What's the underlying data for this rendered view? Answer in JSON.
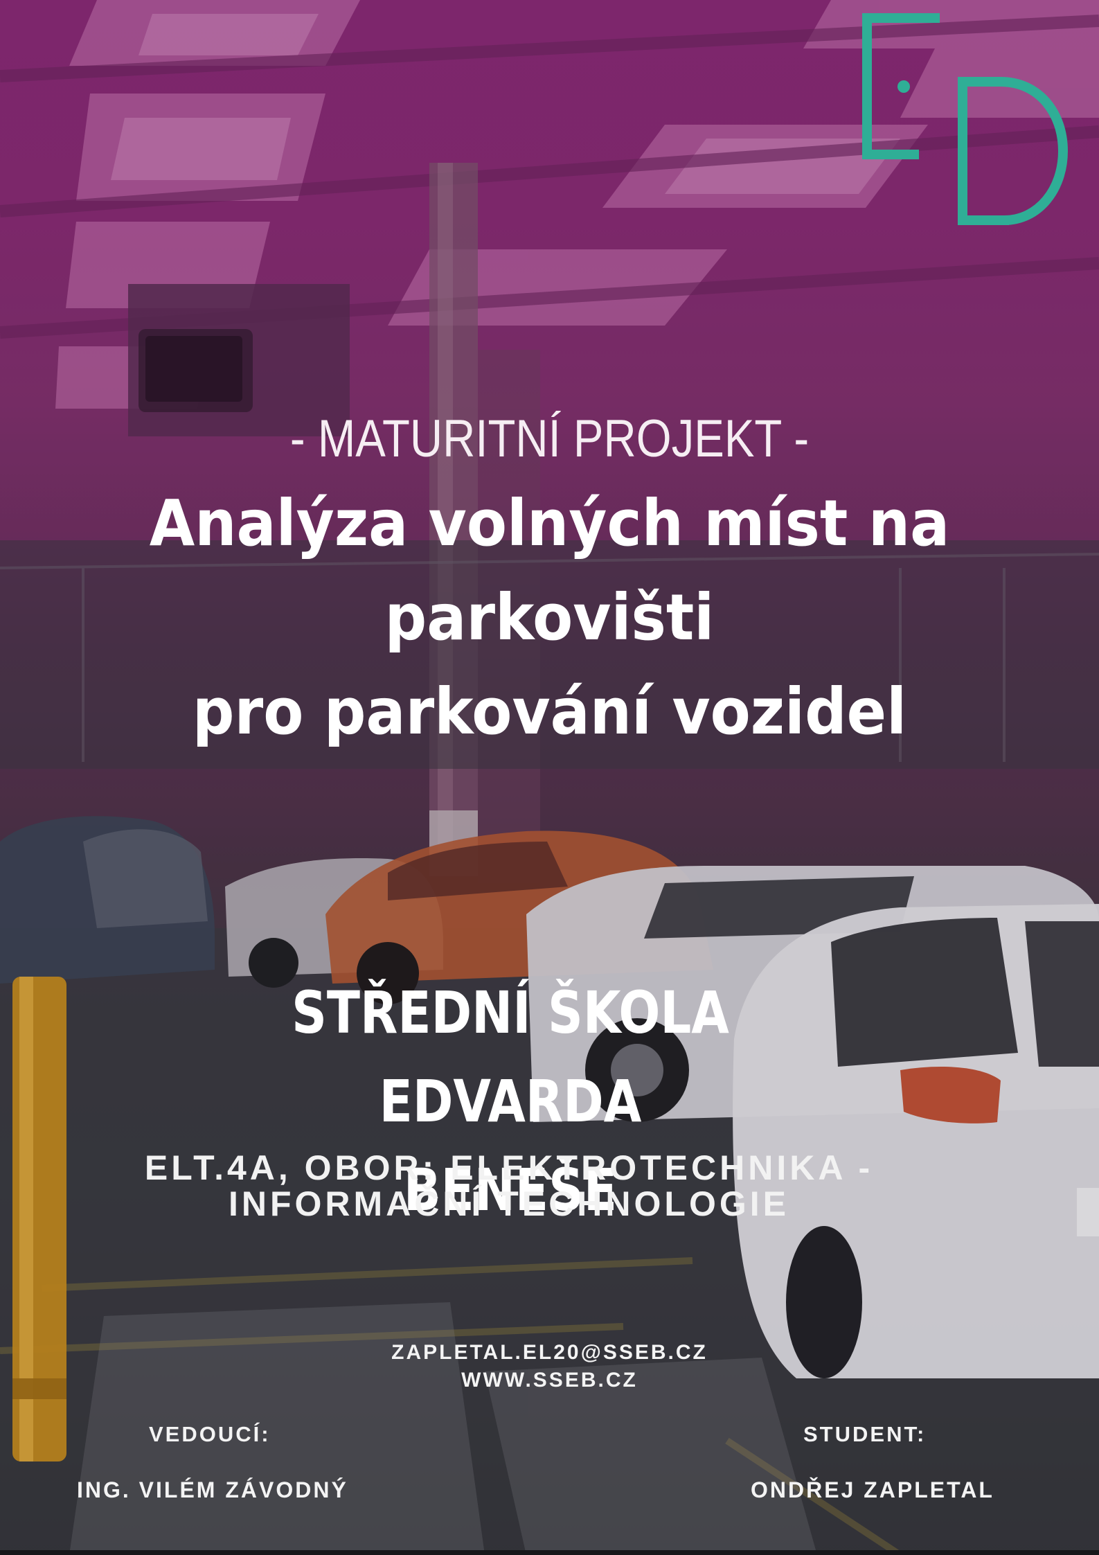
{
  "project_label": "- MATURITNÍ PROJEKT -",
  "title_lines": [
    "Analýza volných míst na",
    "parkovišti",
    "pro parkování vozidel"
  ],
  "school_lines": [
    "STŘEDNÍ ŠKOLA EDVARDA",
    "BENEŠE"
  ],
  "program_lines": [
    "ELT.4A, OBOR: ELEKTROTECHNIKA -",
    "INFORMAČNÍ TECHNOLOGIE"
  ],
  "contact": {
    "email": "ZAPLETAL.EL20@SSEB.CZ",
    "website": "WWW.SSEB.CZ"
  },
  "supervisor": {
    "label": "VEDOUCÍ:",
    "name": "ING. VILÉM ZÁVODNÝ"
  },
  "student": {
    "label": "STUDENT:",
    "name": "ONDŘEJ ZAPLETAL"
  },
  "logo": {
    "letters": "EB",
    "color": "#2fae96"
  },
  "colors": {
    "overlay_top": "#8b2a78",
    "text": "#ffffff",
    "logo": "#2fae96"
  }
}
